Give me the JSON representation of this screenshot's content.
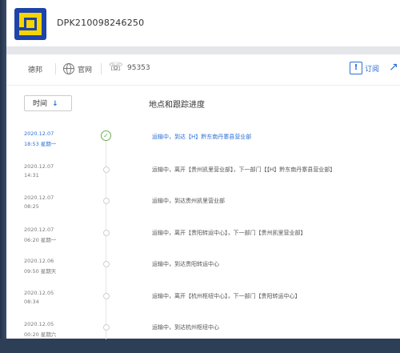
{
  "header": {
    "tracking_number": "DPK210098246250"
  },
  "toolbar": {
    "carrier": "德邦",
    "website_label": "官网",
    "phone": "95353",
    "subscribe_label": "订阅"
  },
  "sort": {
    "label": "时间",
    "arrow": "↓"
  },
  "section_title": "地点和跟踪进度",
  "events": [
    {
      "date": "2020.12.07",
      "time": "18:53 星期一",
      "desc": "运输中，到达【H】黔东南丹寨县营业部",
      "current": true
    },
    {
      "date": "2020.12.07",
      "time": "14:31",
      "desc": "运输中，离开【贵州凯里营业部】，下一部门【【H】黔东南丹寨县营业部】",
      "current": false
    },
    {
      "date": "2020.12.07",
      "time": "08:25",
      "desc": "运输中，到达贵州凯里营业部",
      "current": false
    },
    {
      "date": "2020.12.07",
      "time": "06:20 星期一",
      "desc": "运输中，离开【贵阳转运中心】，下一部门【贵州凯里营业部】",
      "current": false
    },
    {
      "date": "2020.12.06",
      "time": "09:50 星期天",
      "desc": "运输中，到达贵阳转运中心",
      "current": false
    },
    {
      "date": "2020.12.05",
      "time": "08:34",
      "desc": "运输中，离开【杭州枢纽中心】，下一部门【贵阳转运中心】",
      "current": false
    },
    {
      "date": "2020.12.05",
      "time": "00:20 星期六",
      "desc": "运输中，到达杭州枢纽中心",
      "current": false
    }
  ],
  "colors": {
    "accent": "#2a6fd6",
    "success": "#6ab04c",
    "brand_blue": "#1e44a8",
    "brand_yellow": "#f5d400"
  }
}
